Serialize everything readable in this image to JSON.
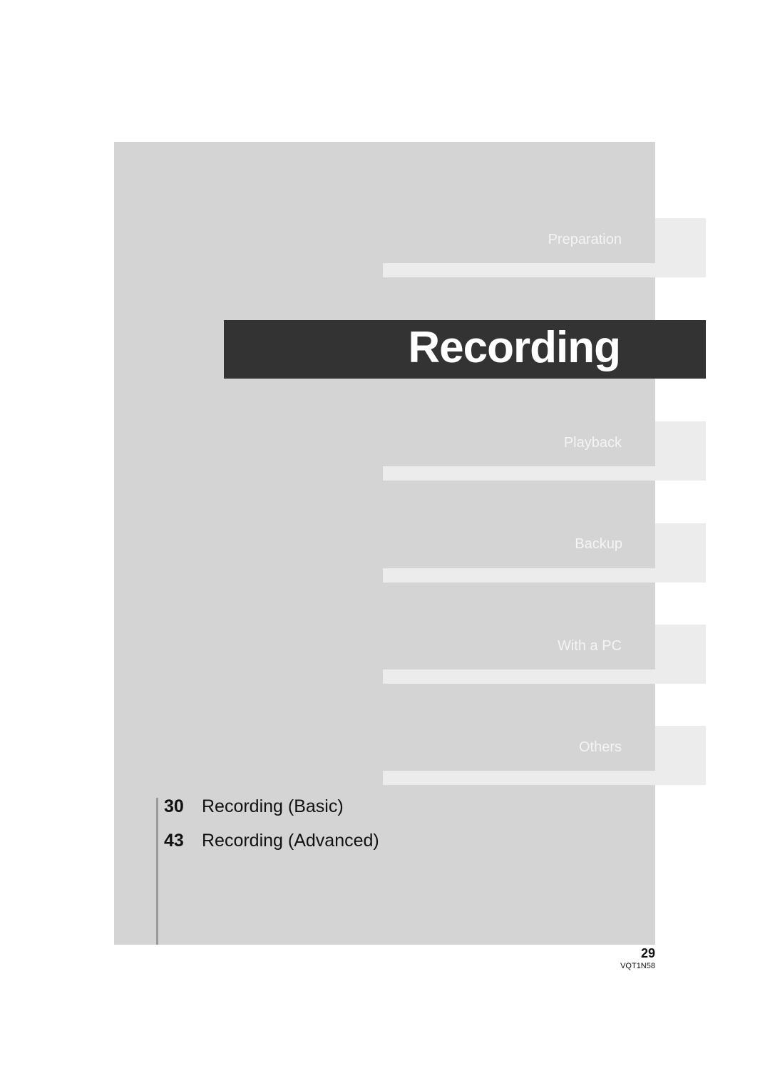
{
  "chapter": {
    "title": "Recording"
  },
  "tabs": [
    {
      "label": "Preparation"
    },
    {
      "label": "Playback"
    },
    {
      "label": "Backup"
    },
    {
      "label": "With a PC"
    },
    {
      "label": "Others"
    }
  ],
  "toc": [
    {
      "page": "30",
      "title": "Recording (Basic)"
    },
    {
      "page": "43",
      "title": "Recording (Advanced)"
    }
  ],
  "footer": {
    "page_number": "29",
    "doc_code": "VQT1N58"
  },
  "colors": {
    "panel": "#d4d4d4",
    "tab": "#ececec",
    "active_bar": "#333333"
  }
}
